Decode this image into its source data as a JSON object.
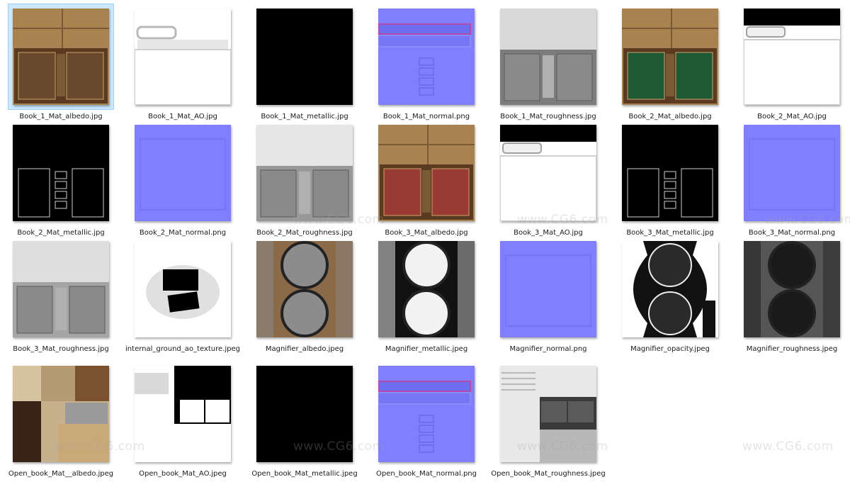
{
  "watermark": "www.CG6.com",
  "files": [
    {
      "name": "Book_1_Mat_albedo.jpg",
      "kind": "book-albedo",
      "palette": [
        "#a8834f",
        "#6a4a2c"
      ],
      "selected": true
    },
    {
      "name": "Book_1_Mat_AO.jpg",
      "kind": "book-ao",
      "palette": [
        "#ffffff",
        "#b8b8b8"
      ]
    },
    {
      "name": "Book_1_Mat_metallic.jpg",
      "kind": "solid",
      "palette": [
        "#000000"
      ]
    },
    {
      "name": "Book_1_Mat_normal.png",
      "kind": "normal",
      "palette": [
        "#8080ff",
        "#6e6ef2"
      ]
    },
    {
      "name": "Book_1_Mat_roughness.jpg",
      "kind": "book-rough",
      "palette": [
        "#d9d9d9",
        "#6b6b6b"
      ]
    },
    {
      "name": "Book_2_Mat_albedo.jpg",
      "kind": "book-albedo",
      "palette": [
        "#a8834f",
        "#1f5a34"
      ]
    },
    {
      "name": "Book_2_Mat_AO.jpg",
      "kind": "book-ao-top",
      "palette": [
        "#ffffff",
        "#000000"
      ]
    },
    {
      "name": "Book_2_Mat_metallic.jpg",
      "kind": "metallic-lines",
      "palette": [
        "#000000",
        "#d0d0d0"
      ]
    },
    {
      "name": "Book_2_Mat_normal.png",
      "kind": "normal-plain",
      "palette": [
        "#8080ff",
        "#7474f4"
      ]
    },
    {
      "name": "Book_2_Mat_roughness.jpg",
      "kind": "book-rough",
      "palette": [
        "#e6e6e6",
        "#8a8a8a"
      ]
    },
    {
      "name": "Book_3_Mat_albedo.jpg",
      "kind": "book-albedo",
      "palette": [
        "#a8834f",
        "#9a3b33"
      ]
    },
    {
      "name": "Book_3_Mat_AO.jpg",
      "kind": "book-ao-top",
      "palette": [
        "#ffffff",
        "#000000"
      ]
    },
    {
      "name": "Book_3_Mat_metallic.jpg",
      "kind": "metallic-lines",
      "palette": [
        "#000000",
        "#d0d0d0"
      ]
    },
    {
      "name": "Book_3_Mat_normal.png",
      "kind": "normal-plain",
      "palette": [
        "#8080ff",
        "#7474f4"
      ]
    },
    {
      "name": "Book_3_Mat_roughness.jpg",
      "kind": "book-rough",
      "palette": [
        "#dedede",
        "#9a9a9a"
      ]
    },
    {
      "name": "internal_ground_ao_texture.jpeg",
      "kind": "ground-ao",
      "palette": [
        "#ffffff",
        "#000000"
      ]
    },
    {
      "name": "Magnifier_albedo.jpeg",
      "kind": "magnifier",
      "palette": [
        "#8a6a48",
        "#8c8c8c"
      ]
    },
    {
      "name": "Magnifier_metallic.jpeg",
      "kind": "magnifier",
      "palette": [
        "#111111",
        "#f2f2f2"
      ]
    },
    {
      "name": "Magnifier_normal.png",
      "kind": "normal-plain",
      "palette": [
        "#8080ff",
        "#7474f4"
      ]
    },
    {
      "name": "Magnifier_opacity.jpeg",
      "kind": "magnifier-opacity",
      "palette": [
        "#ffffff",
        "#111111"
      ]
    },
    {
      "name": "Magnifier_roughness.jpeg",
      "kind": "magnifier",
      "palette": [
        "#555555",
        "#1a1a1a"
      ]
    },
    {
      "name": "Open_book_Mat__albedo.jpeg",
      "kind": "open-albedo",
      "palette": [
        "#c7b08c",
        "#3a2418"
      ]
    },
    {
      "name": "Open_book_Mat_AO.jpeg",
      "kind": "open-ao",
      "palette": [
        "#ffffff",
        "#000000"
      ]
    },
    {
      "name": "Open_book_Mat_metallic.jpeg",
      "kind": "solid",
      "palette": [
        "#000000"
      ]
    },
    {
      "name": "Open_book_Mat_normal.png",
      "kind": "normal",
      "palette": [
        "#8080ff",
        "#6e6ef2"
      ]
    },
    {
      "name": "Open_book_Mat_roughness.jpeg",
      "kind": "open-rough",
      "palette": [
        "#e8e8e8",
        "#3a3a3a"
      ]
    }
  ]
}
